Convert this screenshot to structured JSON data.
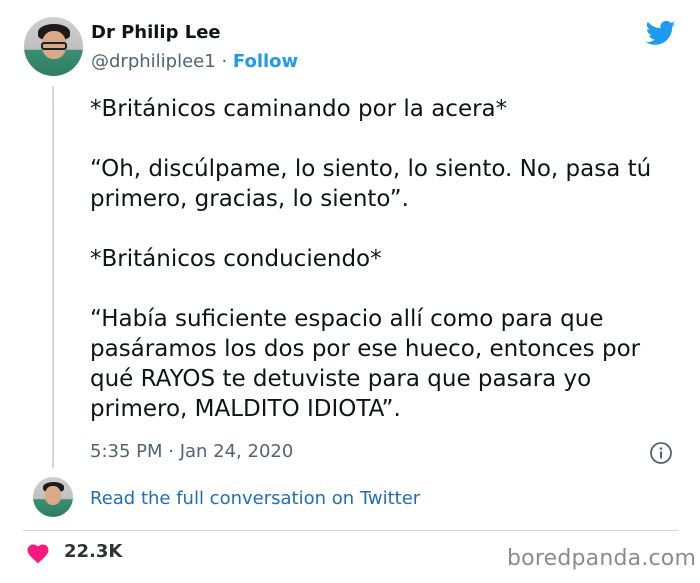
{
  "author": {
    "name": "Dr Philip Lee",
    "handle": "@drphiliplee1",
    "separator": "·",
    "follow_label": "Follow"
  },
  "tweet": {
    "paragraphs": [
      "*Británicos caminando por la acera*",
      "“Oh, discúlpame, lo siento, lo siento. No, pasa tú\nprimero, gracias, lo siento”.",
      "*Británicos conduciendo*",
      "“Había suficiente espacio allí como para que\npasáramos los dos por ese hueco, entonces por\nqué RAYOS te detuviste para que pasara yo\nprimero, MALDITO IDIOTA”."
    ],
    "timestamp": "5:35 PM · Jan 24, 2020"
  },
  "footer": {
    "read_link": "Read the full conversation on Twitter",
    "likes": "22.3K",
    "watermark": "boredpanda.com"
  },
  "icons": {
    "logo": "twitter-bird-icon",
    "info": "info-icon",
    "like": "heart-icon"
  },
  "colors": {
    "brand": "#1d9bf0",
    "link": "#1d6fb8",
    "heart": "#f91880",
    "muted": "#536471"
  }
}
